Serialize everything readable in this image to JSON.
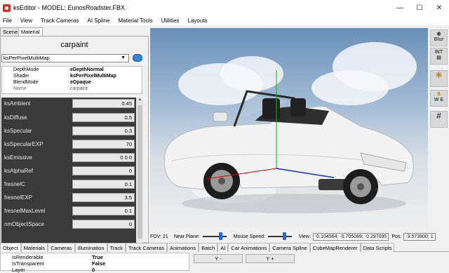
{
  "window": {
    "title": "ksEditor - MODEL: EunosRoadster.FBX",
    "minimize": "—",
    "maximize": "☐",
    "close": "✕"
  },
  "menu": [
    "File",
    "View",
    "Track Cameras",
    "AI Spline",
    "Material Tools",
    "Utilities",
    "Layouts"
  ],
  "left_tabs": [
    "Scene",
    "Material"
  ],
  "material": {
    "name": "carpaint",
    "shader": "ksPerPixelMultiMap",
    "properties": [
      {
        "key": "DepthMode",
        "value": "eDepthNormal"
      },
      {
        "key": "Shader",
        "value": "ksPerPixelMultiMap"
      },
      {
        "key": "BlendMode",
        "value": "eOpaque"
      },
      {
        "key": "Name",
        "value": "carpaint"
      }
    ],
    "params": [
      {
        "label": "ksAmbient",
        "value": "0.45"
      },
      {
        "label": "ksDiffuse",
        "value": "0.5"
      },
      {
        "label": "ksSpecular",
        "value": "0.3"
      },
      {
        "label": "ksSpecularEXP",
        "value": "70"
      },
      {
        "label": "ksEmissive",
        "value": "0 0 0"
      },
      {
        "label": "ksAlphaRef",
        "value": "0"
      },
      {
        "label": "fresnelC",
        "value": "0.1"
      },
      {
        "label": "fresnelEXP",
        "value": "3.5"
      },
      {
        "label": "fresnelMaxLevel",
        "value": "0.1"
      },
      {
        "label": "nmObjectSpace",
        "value": "0"
      }
    ]
  },
  "right_tools": [
    {
      "icon": "blur-icon",
      "label": "Blur"
    },
    {
      "icon": "int-icon",
      "label": "INT"
    },
    {
      "icon": "light-icon",
      "label": ""
    },
    {
      "icon": "wind-icon",
      "label": "W E"
    },
    {
      "icon": "grid-icon",
      "label": ""
    }
  ],
  "status": {
    "fov": "FOV: 21",
    "near_plane": "Near Plane:",
    "near_plane_level": 0.75,
    "mouse_speed": "Mouse Speed:",
    "mouse_speed_level": 0.7,
    "view_label": "View:",
    "view_value": "-0.104564; -0.705089; -0.297095",
    "pos_label": "Pos:",
    "pos_value": "-3.573900; 1"
  },
  "bottom_tabs": [
    "Object",
    "Materials",
    "Cameras",
    "Illumination",
    "Track",
    "Track Cameras",
    "Animations",
    "Batch",
    "AI",
    "Car Animations",
    "Camera Spline",
    "CubeMapRenderer",
    "Data Scripts"
  ],
  "object_props": [
    {
      "key": "IsRenderable",
      "value": "True"
    },
    {
      "key": "IsTransparent",
      "value": "False"
    },
    {
      "key": "Layer",
      "value": "0"
    }
  ],
  "buttons": {
    "y_minus": "Y -",
    "y_plus": "Y +"
  },
  "colors": {
    "accent": "#1e6bd6",
    "param_bg": "#3a3a3a"
  }
}
